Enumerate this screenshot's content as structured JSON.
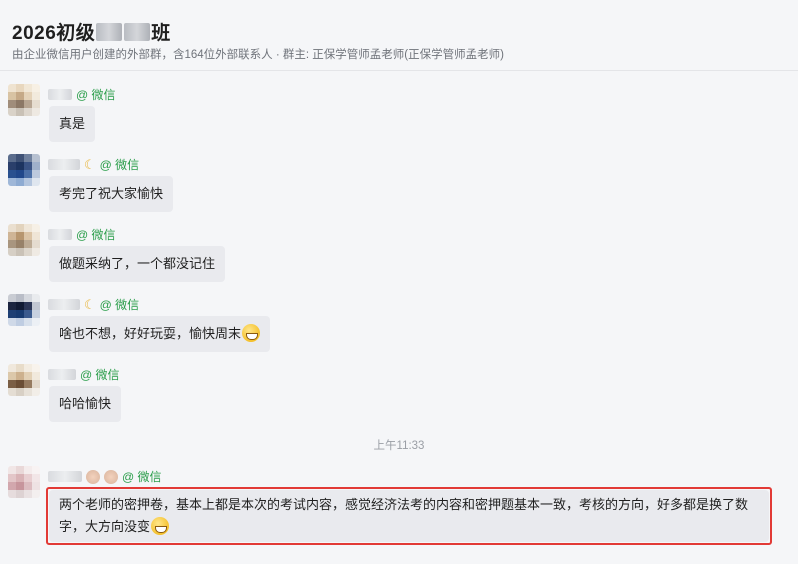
{
  "header": {
    "title_prefix": "2026初级",
    "title_suffix": "班",
    "subtitle": "由企业微信用户创建的外部群，含164位外部联系人 · 群主: 正保学管师孟老师(正保学管师孟老师)"
  },
  "messages": [
    {
      "source": "@ 微信",
      "text": "真是"
    },
    {
      "source": "@ 微信",
      "text": "考完了祝大家愉快"
    },
    {
      "source": "@ 微信",
      "text": "做题采纳了，一个都没记住"
    },
    {
      "source": "@ 微信",
      "text": "啥也不想，好好玩耍，愉快周末"
    },
    {
      "source": "@ 微信",
      "text": "哈哈愉快"
    }
  ],
  "timestamp": "上午11:33",
  "highlighted_message": {
    "source": "@ 微信",
    "text": "两个老师的密押卷，基本上都是本次的考试内容，感觉经济法考的内容和密押题基本一致，考核的方向，好多都是换了数字，大方向没变"
  },
  "colors": {
    "accent_green": "#2a9d4a",
    "highlight_red": "#e23a36",
    "bubble_bg": "#e9eaee"
  }
}
